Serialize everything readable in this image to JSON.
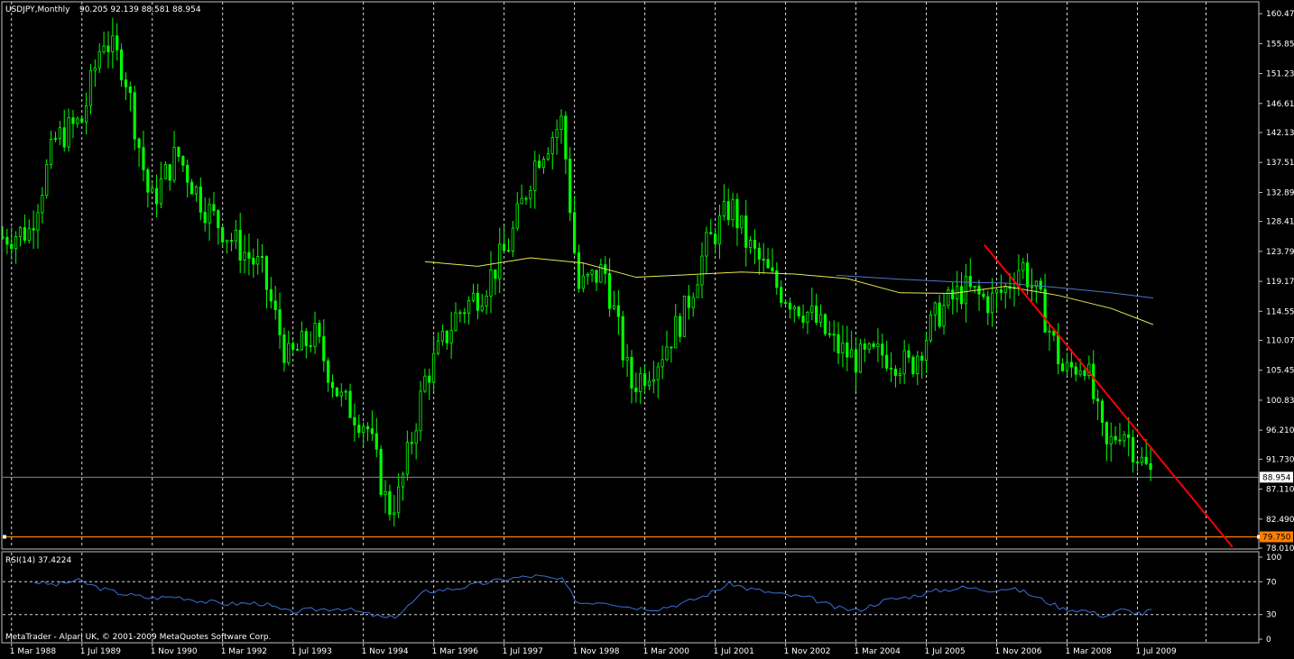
{
  "window": {
    "symbol_header": "USDJPY,Monthly",
    "ohlc_header": "90.205 92.139 88.581 88.954",
    "rsi_header": "RSI(14) 37.4224",
    "copyright": "MetaTrader - Alpari UK, © 2001-2009 MetaQuotes Software Corp."
  },
  "colors": {
    "background": "#000000",
    "candles": "#00ff00",
    "grid": "#ffffff",
    "sma_yellow": "#e8e850",
    "sma_blue": "#4a78c8",
    "trendline": "#ff0000",
    "horizontal_line": "#ff8000",
    "current_price_line": "#7a8aa0",
    "rsi_line": "#3a6fd8",
    "frame": "#c0c0c0"
  },
  "chart_data": [
    {
      "type": "candlestick",
      "title": "USDJPY,Monthly",
      "y_ticks": [
        "160.470",
        "155.850",
        "151.230",
        "146.610",
        "142.130",
        "137.510",
        "132.890",
        "128.410",
        "123.790",
        "119.170",
        "114.550",
        "110.070",
        "105.450",
        "100.830",
        "96.210",
        "91.730",
        "87.110",
        "82.490",
        "78.010"
      ],
      "ylim": [
        78.01,
        162.3
      ],
      "x_ticks": [
        "1 Mar 1988",
        "1 Jul 1989",
        "1 Nov 1990",
        "1 Mar 1992",
        "1 Jul 1993",
        "1 Nov 1994",
        "1 Mar 1996",
        "1 Jul 1997",
        "1 Nov 1998",
        "1 Mar 2000",
        "1 Jul 2001",
        "1 Nov 2002",
        "1 Mar 2004",
        "1 Jul 2005",
        "1 Nov 2006",
        "1 Mar 2008",
        "1 Jul 2009"
      ],
      "xlim": [
        1988.0,
        2011.8
      ],
      "close_series": {
        "name": "USDJPY",
        "x": [
          1988.0,
          1988.5,
          1989.0,
          1989.5,
          1989.9,
          1990.3,
          1990.8,
          1991.3,
          1991.8,
          1992.3,
          1992.9,
          1993.4,
          1993.9,
          1994.4,
          1994.9,
          1995.3,
          1995.5,
          1996.0,
          1996.6,
          1997.1,
          1997.6,
          1998.1,
          1998.6,
          1998.9,
          1999.4,
          1999.9,
          2000.4,
          2000.9,
          2001.3,
          2001.8,
          2002.1,
          2002.7,
          2003.3,
          2003.8,
          2004.2,
          2004.7,
          2005.2,
          2005.7,
          2006.2,
          2006.7,
          2007.0,
          2007.3,
          2007.7,
          2008.1,
          2008.5,
          2008.9,
          2009.2,
          2009.6,
          2009.8
        ],
        "values": [
          126,
          127,
          141,
          144,
          157,
          152,
          131,
          139,
          131,
          126,
          121,
          107,
          111,
          101,
          97,
          84,
          86,
          104,
          114,
          118,
          125,
          138,
          144,
          118,
          121,
          103,
          107,
          114,
          124,
          131,
          125,
          118,
          114,
          109,
          107,
          108,
          106,
          114,
          118,
          116,
          118,
          122,
          115,
          105,
          107,
          93,
          97,
          91,
          89
        ]
      },
      "current_price": "88.954",
      "horizontal_line": "79.750",
      "sma_yellow": {
        "x": [
          1996.0,
          1997.0,
          1998.0,
          1999.0,
          2000.0,
          2001.0,
          2002.0,
          2003.0,
          2004.0,
          2005.0,
          2006.0,
          2007.0,
          2008.0,
          2009.0,
          2009.8
        ],
        "values": [
          122.2,
          121.5,
          122.8,
          122.0,
          119.8,
          120.2,
          120.6,
          120.3,
          119.6,
          117.4,
          117.3,
          118.4,
          117.0,
          115.0,
          112.5
        ]
      },
      "sma_blue": {
        "x": [
          2003.8,
          2005.0,
          2006.0,
          2007.0,
          2008.0,
          2009.0,
          2009.8
        ],
        "values": [
          120.1,
          119.5,
          119.1,
          118.9,
          118.2,
          117.4,
          116.6
        ]
      },
      "trendline": {
        "x": [
          2006.6,
          2011.3
        ],
        "values": [
          124.8,
          78.2
        ]
      }
    },
    {
      "type": "line",
      "title": "RSI(14) 37.4224",
      "y_ticks": [
        "100",
        "70",
        "30",
        "0"
      ],
      "ylim": [
        0,
        100
      ],
      "levels": [
        70,
        30
      ],
      "series": [
        {
          "name": "RSI(14)",
          "x": [
            1988.6,
            1989.0,
            1989.4,
            1989.9,
            1990.3,
            1990.8,
            1991.3,
            1991.8,
            1992.3,
            1992.9,
            1993.4,
            1993.9,
            1994.4,
            1994.9,
            1995.3,
            1995.5,
            1996.0,
            1996.6,
            1997.1,
            1997.6,
            1998.1,
            1998.6,
            1998.9,
            1999.4,
            1999.9,
            2000.4,
            2000.9,
            2001.3,
            2001.8,
            2002.1,
            2002.7,
            2003.3,
            2003.8,
            2004.2,
            2004.7,
            2005.2,
            2005.7,
            2006.2,
            2006.7,
            2007.0,
            2007.3,
            2007.7,
            2008.1,
            2008.5,
            2008.9,
            2009.2,
            2009.6,
            2009.8
          ],
          "values": [
            70,
            66,
            72,
            61,
            55,
            50,
            52,
            46,
            43,
            44,
            33,
            36,
            38,
            31,
            25,
            30,
            58,
            62,
            68,
            74,
            77,
            72,
            44,
            46,
            39,
            37,
            44,
            53,
            68,
            62,
            55,
            50,
            38,
            35,
            47,
            52,
            59,
            63,
            60,
            62,
            59,
            48,
            37,
            35,
            28,
            36,
            31,
            37
          ]
        }
      ]
    }
  ]
}
